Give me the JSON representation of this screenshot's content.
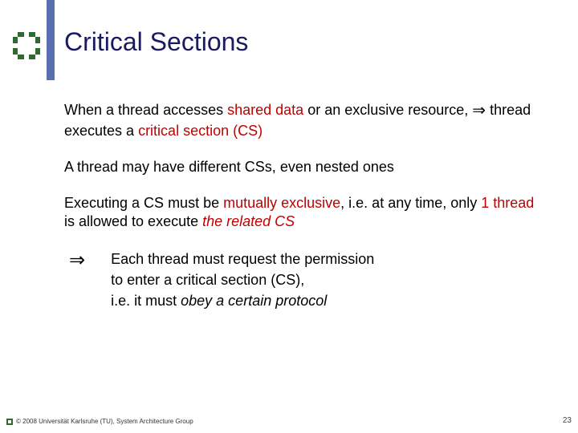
{
  "title": "Critical Sections",
  "paragraphs": {
    "p1_a": "When a thread accesses ",
    "p1_shared": "shared data",
    "p1_b": " or an exclusive resource, ",
    "p1_arrow": "⇒",
    "p1_c": " thread executes a ",
    "p1_cs": "critical section (CS)",
    "p2": "A thread may have different CSs, even nested ones",
    "p3_a": "Executing a CS must be ",
    "p3_mutex": "mutually exclusive",
    "p3_b": ", i.e. at any time, only ",
    "p3_one": "1 thread",
    "p3_c": " is allowed to execute ",
    "p3_related": "the related CS",
    "p4_arrow": "⇒",
    "p4_a": "Each thread must request the permission",
    "p4_b": "to enter a critical section (CS),",
    "p4_c": "i.e. it must ",
    "p4_obey": "obey a certain protocol"
  },
  "footer": {
    "copyright": "© 2008 Universität Karlsruhe (TU), System Architecture Group",
    "page": "23"
  }
}
